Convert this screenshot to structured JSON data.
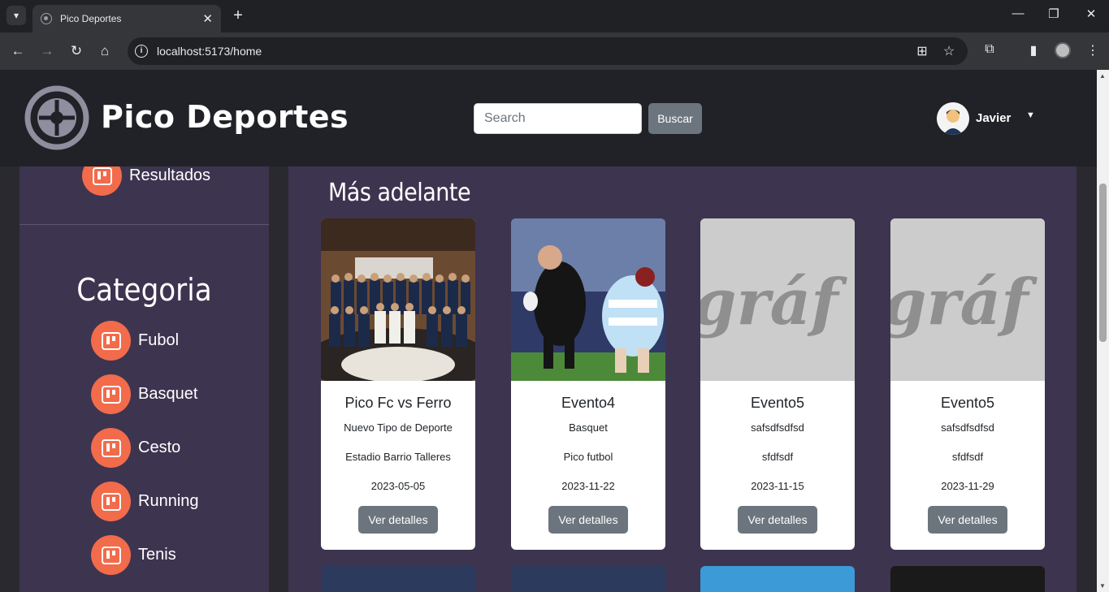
{
  "browser": {
    "tab_title": "Pico Deportes",
    "url": "localhost:5173/home"
  },
  "header": {
    "brand": "Pico Deportes",
    "search_placeholder": "Search",
    "search_button": "Buscar",
    "user_name": "Javier"
  },
  "sidebar": {
    "top_item": "Resultados",
    "category_title": "Categoria",
    "categories": [
      "Fubol",
      "Basquet",
      "Cesto",
      "Running",
      "Tenis"
    ]
  },
  "main": {
    "section_title": "Más adelante",
    "cards": [
      {
        "title": "Pico Fc vs Ferro",
        "sport": "Nuevo Tipo de Deporte",
        "venue": "Estadio Barrio Talleres",
        "date": "2023-05-05",
        "button": "Ver detalles",
        "image": "basketball-team-photo"
      },
      {
        "title": "Evento4",
        "sport": "Basquet",
        "venue": "Pico futbol",
        "date": "2023-11-22",
        "button": "Ver detalles",
        "image": "rugby-player-photo"
      },
      {
        "title": "Evento5",
        "sport": "safsdfsdfsd",
        "venue": "sfdfsdf",
        "date": "2023-11-15",
        "button": "Ver detalles",
        "image": "grafico-placeholder"
      },
      {
        "title": "Evento5",
        "sport": "safsdfsdfsd",
        "venue": "sfdfsdf",
        "date": "2023-11-29",
        "button": "Ver detalles",
        "image": "grafico-placeholder"
      }
    ]
  },
  "colors": {
    "header_bg": "#202227",
    "panel_bg": "#3d3450",
    "accent": "#f26b4b",
    "button": "#6c757d"
  }
}
